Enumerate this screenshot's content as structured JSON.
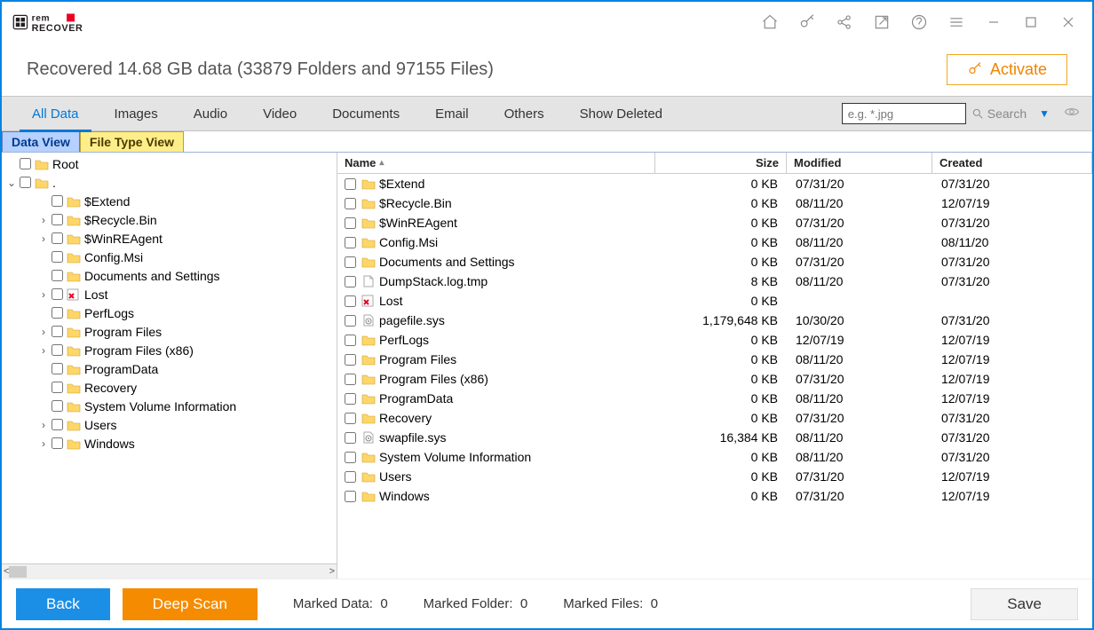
{
  "info": {
    "summary": "Recovered 14.68 GB data (33879 Folders and 97155 Files)"
  },
  "activate": {
    "label": "Activate"
  },
  "filters": {
    "items": [
      "All Data",
      "Images",
      "Audio",
      "Video",
      "Documents",
      "Email",
      "Others",
      "Show Deleted"
    ],
    "active_index": 0,
    "search_placeholder": "e.g. *.jpg",
    "search_label": "Search"
  },
  "viewtabs": {
    "data": "Data View",
    "filetype": "File Type View"
  },
  "tree": {
    "root": "Root",
    "dot": ".",
    "items": [
      {
        "label": "$Extend",
        "expandable": false
      },
      {
        "label": "$Recycle.Bin",
        "expandable": true
      },
      {
        "label": "$WinREAgent",
        "expandable": true
      },
      {
        "label": "Config.Msi",
        "expandable": false
      },
      {
        "label": "Documents and Settings",
        "expandable": false
      },
      {
        "label": "Lost",
        "expandable": true,
        "lost": true
      },
      {
        "label": "PerfLogs",
        "expandable": false
      },
      {
        "label": "Program Files",
        "expandable": true
      },
      {
        "label": "Program Files (x86)",
        "expandable": true
      },
      {
        "label": "ProgramData",
        "expandable": false
      },
      {
        "label": "Recovery",
        "expandable": false
      },
      {
        "label": "System Volume Information",
        "expandable": false
      },
      {
        "label": "Users",
        "expandable": true
      },
      {
        "label": "Windows",
        "expandable": true
      }
    ]
  },
  "columns": {
    "name": "Name",
    "size": "Size",
    "modified": "Modified",
    "created": "Created"
  },
  "rows": [
    {
      "name": "$Extend",
      "type": "folder",
      "size": "0 KB",
      "modified": "07/31/20",
      "created": "07/31/20"
    },
    {
      "name": "$Recycle.Bin",
      "type": "folder",
      "size": "0 KB",
      "modified": "08/11/20",
      "created": "12/07/19"
    },
    {
      "name": "$WinREAgent",
      "type": "folder",
      "size": "0 KB",
      "modified": "07/31/20",
      "created": "07/31/20"
    },
    {
      "name": "Config.Msi",
      "type": "folder",
      "size": "0 KB",
      "modified": "08/11/20",
      "created": "08/11/20"
    },
    {
      "name": "Documents and Settings",
      "type": "folder",
      "size": "0 KB",
      "modified": "07/31/20",
      "created": "07/31/20"
    },
    {
      "name": "DumpStack.log.tmp",
      "type": "file",
      "size": "8 KB",
      "modified": "08/11/20",
      "created": "07/31/20"
    },
    {
      "name": "Lost",
      "type": "lost",
      "size": "0 KB",
      "modified": "",
      "created": ""
    },
    {
      "name": "pagefile.sys",
      "type": "sys",
      "size": "1,179,648 KB",
      "modified": "10/30/20",
      "created": "07/31/20"
    },
    {
      "name": "PerfLogs",
      "type": "folder",
      "size": "0 KB",
      "modified": "12/07/19",
      "created": "12/07/19"
    },
    {
      "name": "Program Files",
      "type": "folder",
      "size": "0 KB",
      "modified": "08/11/20",
      "created": "12/07/19"
    },
    {
      "name": "Program Files (x86)",
      "type": "folder",
      "size": "0 KB",
      "modified": "07/31/20",
      "created": "12/07/19"
    },
    {
      "name": "ProgramData",
      "type": "folder",
      "size": "0 KB",
      "modified": "08/11/20",
      "created": "12/07/19"
    },
    {
      "name": "Recovery",
      "type": "folder",
      "size": "0 KB",
      "modified": "07/31/20",
      "created": "07/31/20"
    },
    {
      "name": "swapfile.sys",
      "type": "sys",
      "size": "16,384 KB",
      "modified": "08/11/20",
      "created": "07/31/20"
    },
    {
      "name": "System Volume Information",
      "type": "folder",
      "size": "0 KB",
      "modified": "08/11/20",
      "created": "07/31/20"
    },
    {
      "name": "Users",
      "type": "folder",
      "size": "0 KB",
      "modified": "07/31/20",
      "created": "12/07/19"
    },
    {
      "name": "Windows",
      "type": "folder",
      "size": "0 KB",
      "modified": "07/31/20",
      "created": "12/07/19"
    }
  ],
  "footer": {
    "back": "Back",
    "deep": "Deep Scan",
    "save": "Save",
    "marked_data_label": "Marked Data:",
    "marked_data_value": "0",
    "marked_folder_label": "Marked Folder:",
    "marked_folder_value": "0",
    "marked_files_label": "Marked Files:",
    "marked_files_value": "0"
  }
}
